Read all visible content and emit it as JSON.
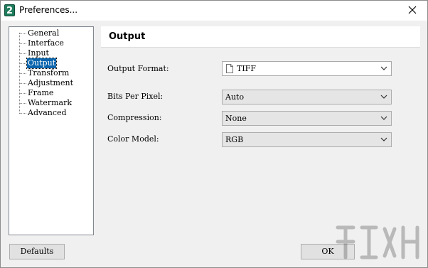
{
  "window": {
    "title": "Preferences...",
    "app_icon_glyph": "2"
  },
  "tree": {
    "items": [
      {
        "label": "General",
        "selected": false
      },
      {
        "label": "Interface",
        "selected": false
      },
      {
        "label": "Input",
        "selected": false
      },
      {
        "label": "Output",
        "selected": true
      },
      {
        "label": "Transform",
        "selected": false
      },
      {
        "label": "Adjustment",
        "selected": false
      },
      {
        "label": "Frame",
        "selected": false
      },
      {
        "label": "Watermark",
        "selected": false
      },
      {
        "label": "Advanced",
        "selected": false
      }
    ]
  },
  "panel": {
    "title": "Output",
    "fields": [
      {
        "label": "Output Format:",
        "value": "TIFF",
        "icon": "file-icon"
      },
      {
        "label": "Bits Per Pixel:",
        "value": "Auto"
      },
      {
        "label": "Compression:",
        "value": "None"
      },
      {
        "label": "Color Model:",
        "value": "RGB"
      }
    ]
  },
  "buttons": {
    "defaults": "Defaults",
    "ok": "OK"
  },
  "colors": {
    "selection": "#0a64ad",
    "icon_green": "#1e7b5b"
  }
}
